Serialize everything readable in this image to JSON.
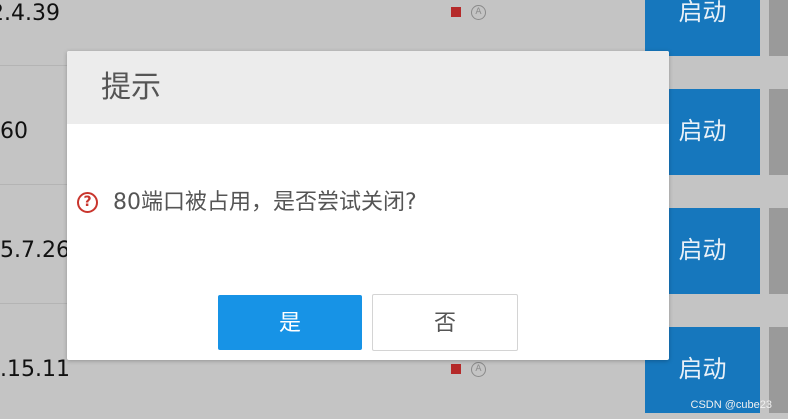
{
  "background_rows": [
    {
      "version": "2.4.39",
      "status_auto": "A",
      "start_label": "启动"
    },
    {
      "version": "60",
      "start_label": "启动"
    },
    {
      "version": "5.7.26",
      "start_label": "启动"
    },
    {
      "version": ".15.11",
      "status_auto": "A",
      "start_label": "启动"
    }
  ],
  "dialog": {
    "title": "提示",
    "question_icon": "?",
    "message": "80端口被占用，是否尝试关闭?",
    "yes_label": "是",
    "no_label": "否"
  },
  "watermark": "CSDN @cube23",
  "colors": {
    "start_button": "#1677bd",
    "yes_button": "#1793e6",
    "status_stopped": "#b52a2a",
    "question_icon": "#c9352d"
  },
  "icons": {
    "status": "stopped-square-icon",
    "auto": "auto-start-circle-icon",
    "question": "question-circle-icon"
  }
}
